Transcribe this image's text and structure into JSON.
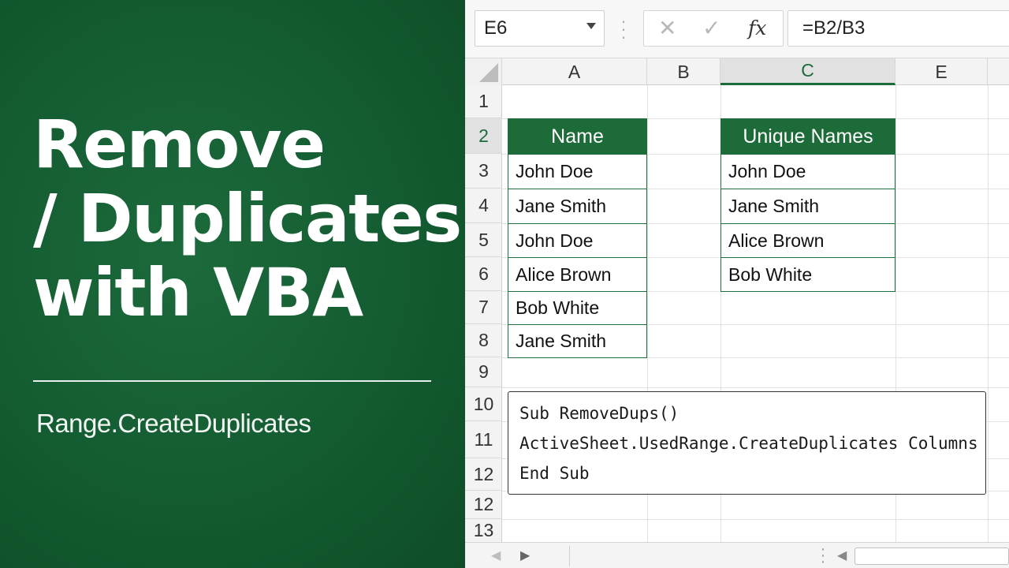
{
  "left_panel": {
    "title_lines": [
      "Remove",
      "/ Duplicates /",
      "with VBA"
    ],
    "subtitle": "Range.CreateDuplicates"
  },
  "formula_bar": {
    "name_box": "E6",
    "formula": "=B2/B3",
    "icons": [
      "close-icon",
      "check-icon",
      "fx-icon"
    ]
  },
  "grid": {
    "columns": [
      "A",
      "B",
      "C",
      "E"
    ],
    "active_column": "C",
    "rows": [
      "1",
      "2",
      "3",
      "4",
      "5",
      "6",
      "7",
      "8",
      "9",
      "10",
      "11",
      "12",
      "12",
      "13"
    ],
    "active_row": "2"
  },
  "table_names": {
    "header": "Name",
    "values": [
      "John Doe",
      "Jane Smith",
      "John Doe",
      "Alice Brown",
      "Bob White",
      "Jane Smith"
    ]
  },
  "table_unique": {
    "header": "Unique Names",
    "values": [
      "John Doe",
      "Jane Smith",
      "Alice Brown",
      "Bob White"
    ]
  },
  "code": {
    "lines": [
      "Sub RemoveDups()",
      "ActiveSheet.UsedRange.CreateDuplicates Columns",
      "End Sub"
    ]
  },
  "colors": {
    "panel_green": "#135a30",
    "header_green": "#1e6b3a",
    "border_green": "#1f6e3d"
  }
}
